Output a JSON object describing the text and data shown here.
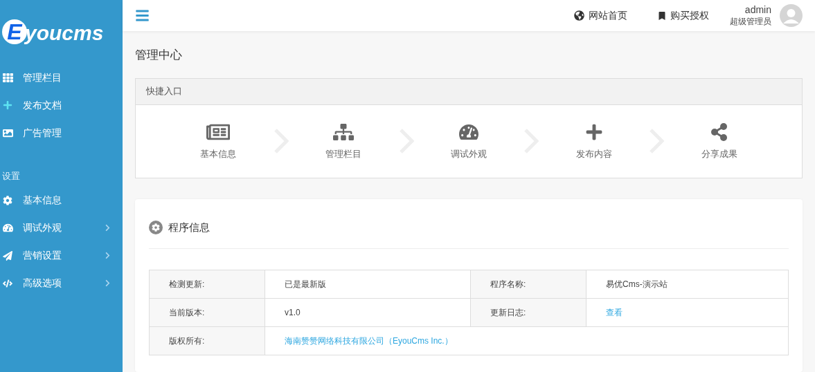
{
  "logo": {
    "initial": "E",
    "rest": "youcms"
  },
  "sidebar": {
    "items": [
      {
        "label": "管理栏目",
        "has_submenu": false
      },
      {
        "label": "发布文档",
        "has_submenu": false
      },
      {
        "label": "广告管理",
        "has_submenu": false
      }
    ],
    "section": "设置",
    "settings_items": [
      {
        "label": "基本信息",
        "has_submenu": false
      },
      {
        "label": "调试外观",
        "has_submenu": true
      },
      {
        "label": "营销设置",
        "has_submenu": true
      },
      {
        "label": "高级选项",
        "has_submenu": true
      }
    ]
  },
  "topbar": {
    "links": [
      "网站首页",
      "购买授权"
    ],
    "user": {
      "name": "admin",
      "role": "超级管理员"
    }
  },
  "page_title": "管理中心",
  "quick_entry": {
    "title": "快捷入口",
    "items": [
      "基本信息",
      "管理栏目",
      "调试外观",
      "发布内容",
      "分享成果"
    ]
  },
  "program_info": {
    "title": "程序信息",
    "rows": [
      [
        {
          "label": "检测更新:",
          "value": "已是最新版",
          "link": false
        },
        {
          "label": "程序名称:",
          "value": "易优Cms-演示站",
          "link": false
        }
      ],
      [
        {
          "label": "当前版本:",
          "value": "v1.0",
          "link": false
        },
        {
          "label": "更新日志:",
          "value": "查看",
          "link": true
        }
      ],
      [
        {
          "label": "版权所有:",
          "value": "海南赞赞网络科技有限公司（EyouCms Inc.）",
          "link": true
        }
      ]
    ]
  }
}
